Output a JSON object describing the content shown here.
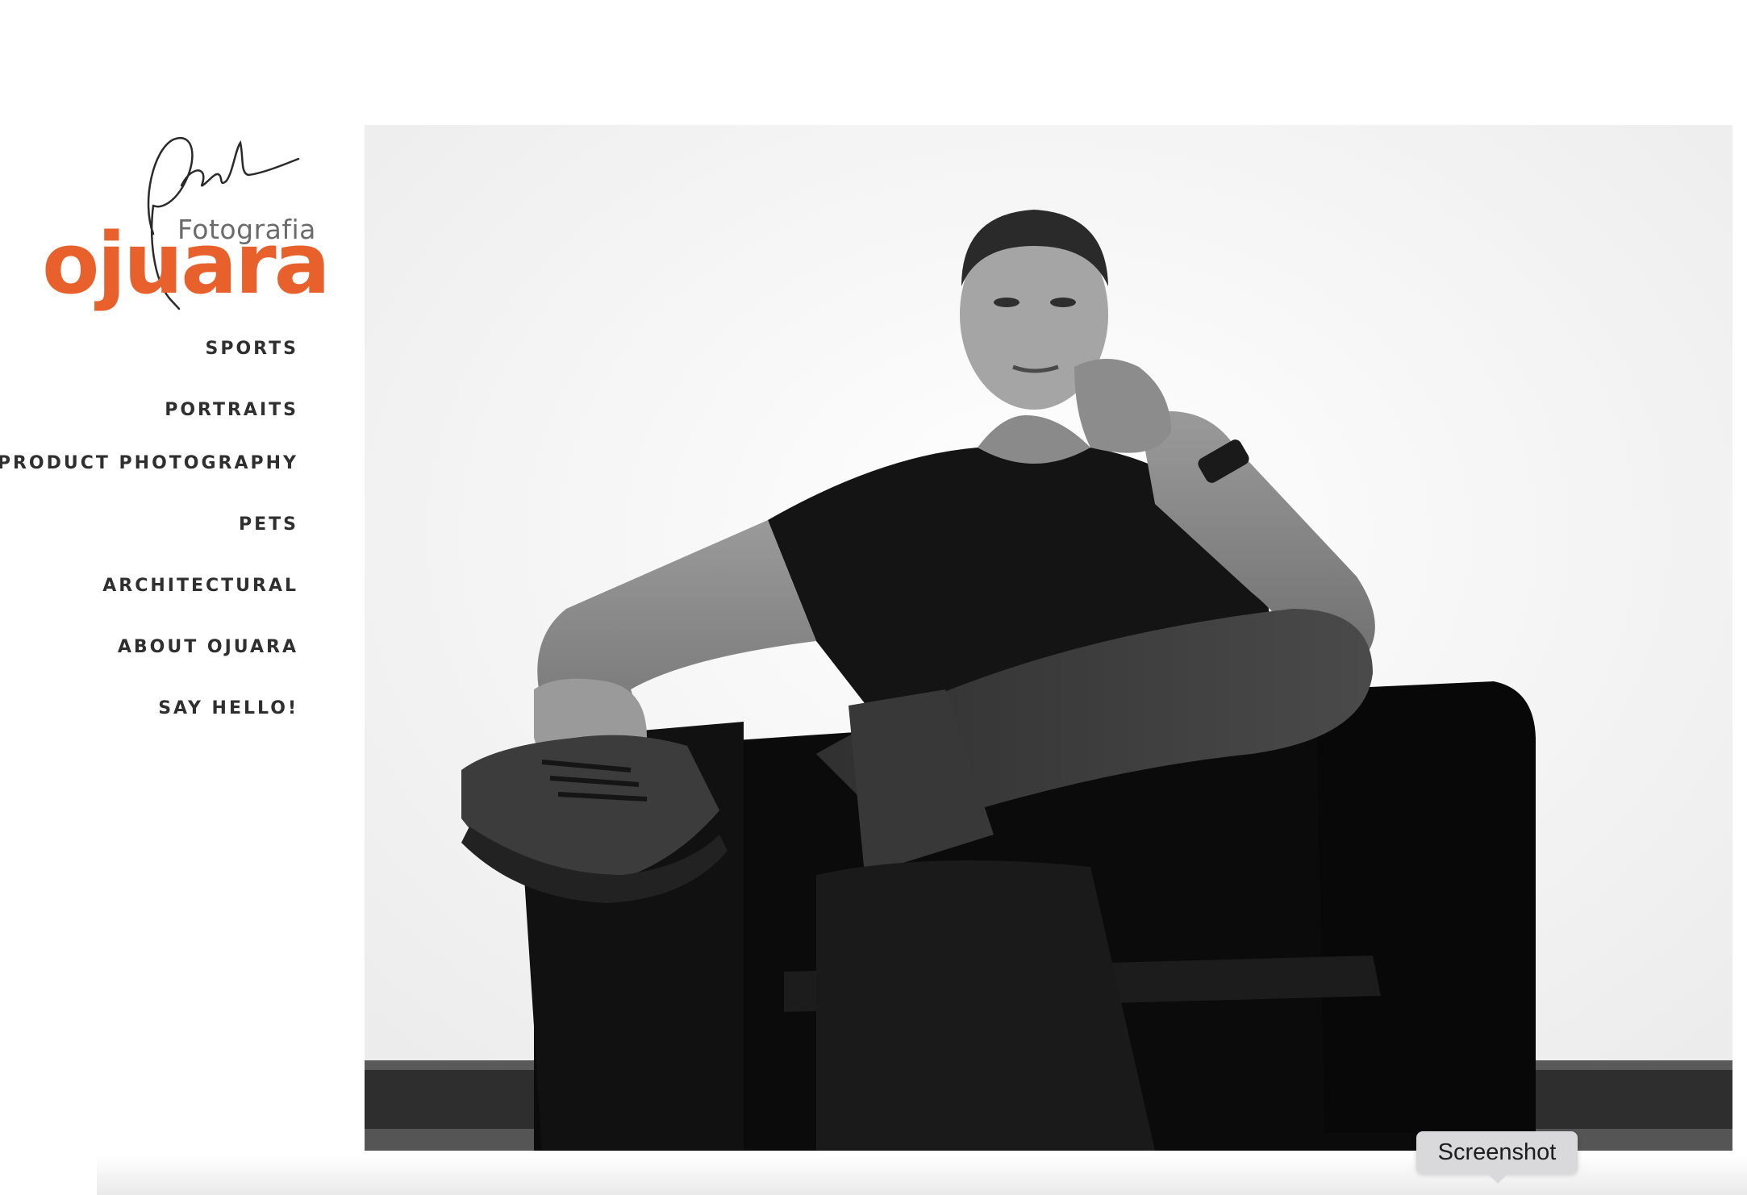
{
  "brand": {
    "signature": "Paul",
    "subtitle": "Fotografia",
    "name": "ojuara",
    "accent_color": "#e8612c"
  },
  "nav": {
    "items": [
      {
        "label": "SPORTS"
      },
      {
        "label": "PORTRAITS"
      },
      {
        "label": "PRODUCT PHOTOGRAPHY"
      },
      {
        "label": "PETS"
      },
      {
        "label": "ARCHITECTURAL"
      },
      {
        "label": "ABOUT OJUARA"
      },
      {
        "label": "SAY HELLO!"
      }
    ]
  },
  "hero": {
    "image": "black-and-white portrait of a man seated in a black leather armchair"
  },
  "tooltip": {
    "label": "Screenshot"
  }
}
